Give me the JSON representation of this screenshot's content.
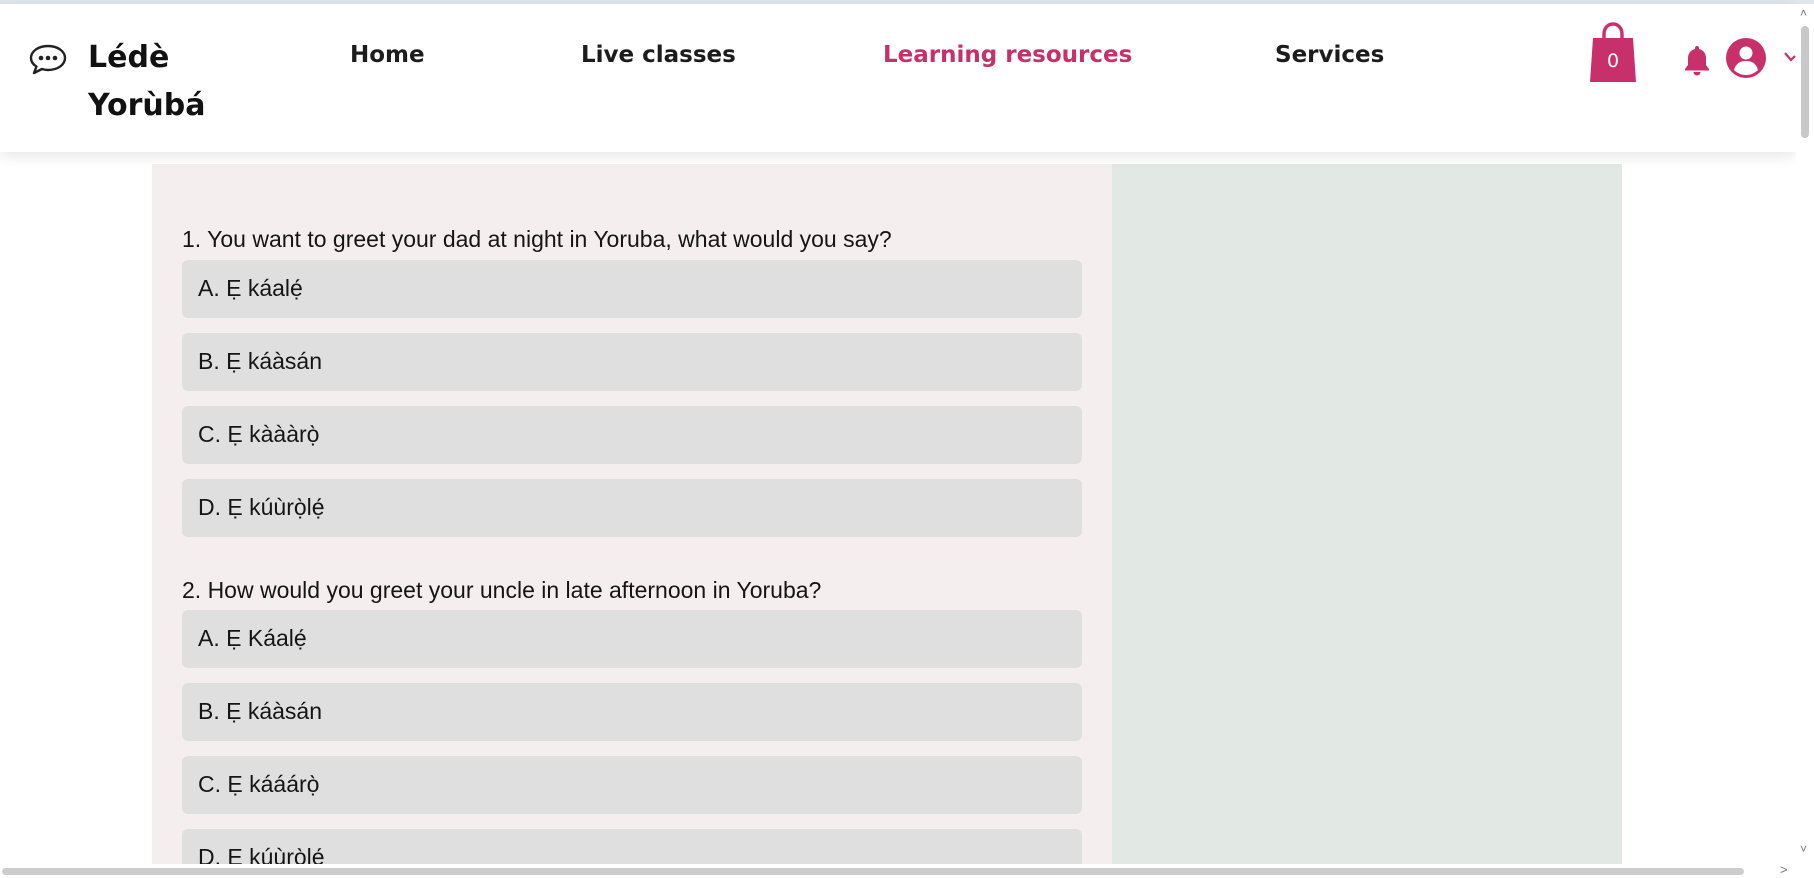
{
  "brand": {
    "line1": "Lédè",
    "line2": "Yorùbá"
  },
  "nav": [
    {
      "label": "Home",
      "active": false
    },
    {
      "label": "Live classes",
      "active": false
    },
    {
      "label": "Learning resources",
      "active": true
    },
    {
      "label": "Services",
      "active": false
    }
  ],
  "cart": {
    "count": "0"
  },
  "accent_color": "#c8306b",
  "icons": [
    "chat-icon",
    "shopping-bag-icon",
    "bell-icon",
    "user-avatar-icon",
    "chevron-down-icon"
  ],
  "quiz": {
    "questions": [
      {
        "text": "1. You want to greet your dad at night in Yoruba, what would you say?",
        "options": [
          "A. Ẹ káalẹ́",
          "B. Ẹ káàsán",
          "C. Ẹ kàààrọ̀",
          "D. Ẹ kúùrọ̀lẹ́"
        ]
      },
      {
        "text": "2. How would you greet your uncle in late afternoon in Yoruba?",
        "options": [
          "A. Ẹ Káalẹ́",
          "B. Ẹ káàsán",
          "C. Ẹ kááárọ̀",
          "D. Ẹ kúùrọ̀lẹ́"
        ]
      }
    ]
  }
}
